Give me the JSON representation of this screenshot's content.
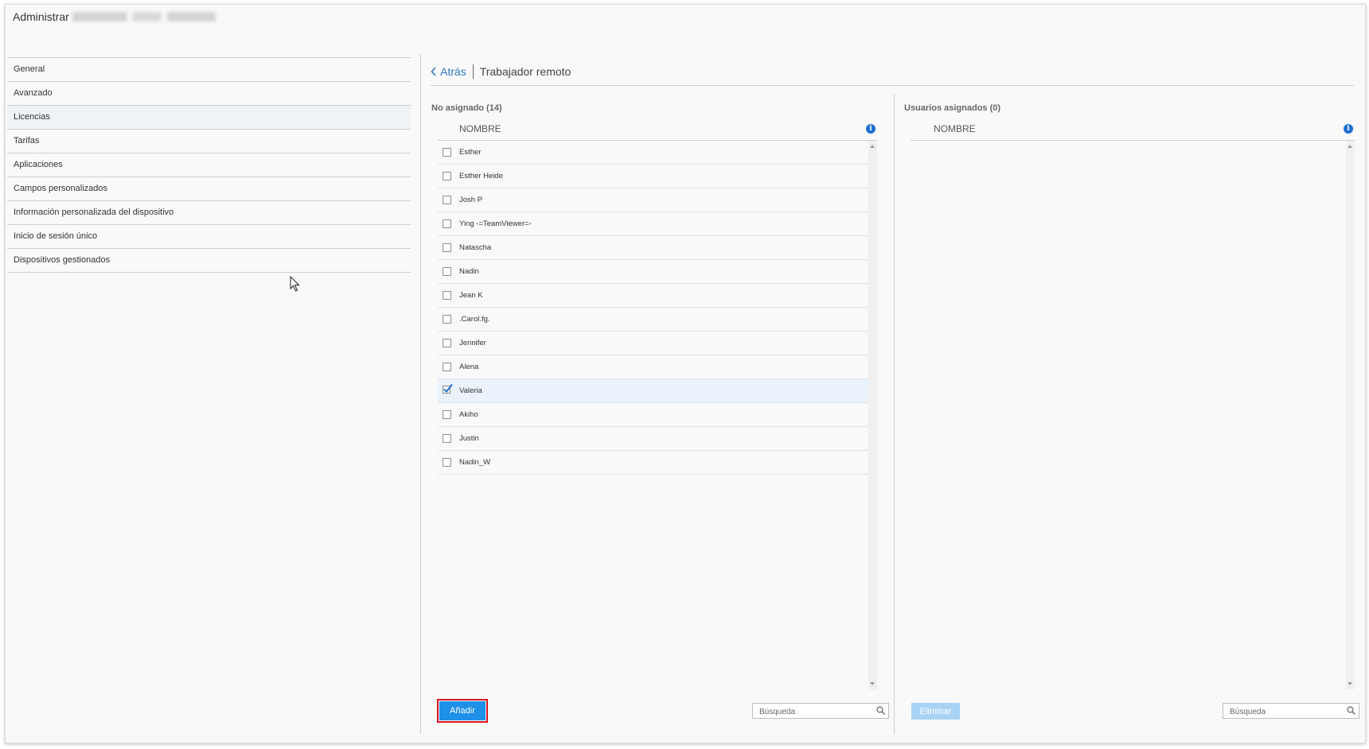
{
  "app": {
    "title": "Administrar"
  },
  "sidebar": {
    "items": [
      {
        "label": "General"
      },
      {
        "label": "Avanzado"
      },
      {
        "label": "Licencias",
        "active": true
      },
      {
        "label": "Tarifas"
      },
      {
        "label": "Aplicaciones"
      },
      {
        "label": "Campos personalizados"
      },
      {
        "label": "Información personalizada del dispositivo"
      },
      {
        "label": "Inicio de sesión único"
      },
      {
        "label": "Dispositivos gestionados"
      }
    ]
  },
  "header": {
    "back_label": "Atrás",
    "title": "Trabajador remoto"
  },
  "unassigned": {
    "title": "No asignado (14)",
    "column": "NOMBRE",
    "users": [
      {
        "name": "Esther",
        "checked": false
      },
      {
        "name": "Esther Heide",
        "checked": false
      },
      {
        "name": "Josh P",
        "checked": false
      },
      {
        "name": "Ying -=TeamViewer=-",
        "checked": false
      },
      {
        "name": "Natascha",
        "checked": false
      },
      {
        "name": "Nadin",
        "checked": false
      },
      {
        "name": "Jean K",
        "checked": false
      },
      {
        "name": ".Carol.fg.",
        "checked": false
      },
      {
        "name": "Jennifer",
        "checked": false
      },
      {
        "name": "Alena",
        "checked": false
      },
      {
        "name": "Valeria",
        "checked": true
      },
      {
        "name": "Akiho",
        "checked": false
      },
      {
        "name": "Justin",
        "checked": false
      },
      {
        "name": "Nadin_W",
        "checked": false
      }
    ],
    "add_label": "Añadir",
    "search_placeholder": "Búsqueda"
  },
  "assigned": {
    "title": "Usuarios asignados (0)",
    "column": "NOMBRE",
    "remove_label": "Eliminar",
    "search_placeholder": "Búsqueda"
  },
  "colors": {
    "accent": "#1e90e8",
    "link": "#2b79c4",
    "highlight_outline": "#e0161d",
    "disabled_button": "#a9d3f5"
  }
}
